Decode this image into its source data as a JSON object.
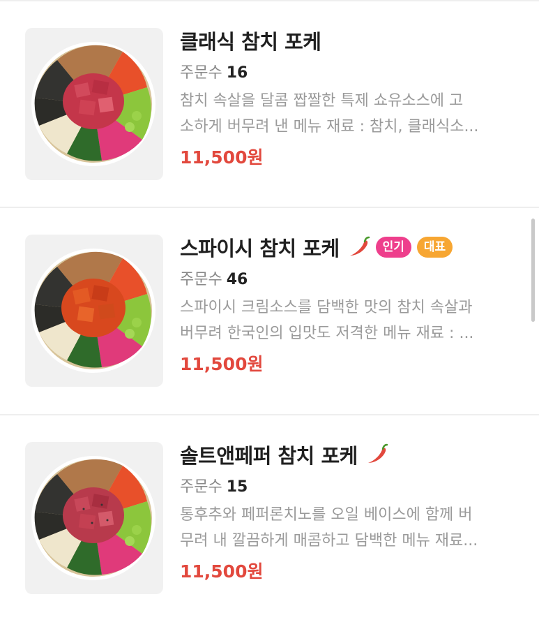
{
  "menu": {
    "orders_label": "주문수",
    "colors": {
      "price": "#e2483d",
      "badge_popular": "#ee3f8c",
      "badge_signature": "#f7a632",
      "chili": "#e2483d"
    },
    "items": [
      {
        "name": "클래식 참치 포케",
        "orders": "16",
        "desc_line1": "참치 속살을 달콤 짭짤한 특제 쇼유소스에 고",
        "desc_line2": "소하게 버무려 낸 메뉴 재료 : 참치, 클래식소...",
        "price": "11,500원",
        "tuna_style": "raw"
      },
      {
        "name": "스파이시 참치 포케",
        "orders": "46",
        "desc_line1": "스파이시 크림소스를 담백한 맛의 참치 속살과",
        "desc_line2": "버무려 한국인의 입맛도 저격한 메뉴 재료 : ...",
        "price": "11,500원",
        "icon": "chili-pepper-icon",
        "badges": [
          "인기",
          "대표"
        ],
        "tuna_style": "spicy"
      },
      {
        "name": "솔트앤페퍼 참치 포케",
        "orders": "15",
        "desc_line1": "통후추와 페퍼론치노를 오일 베이스에 함께 버",
        "desc_line2": "무려 내 깔끔하게 매콤하고 담백한 메뉴 재료...",
        "price": "11,500원",
        "icon": "chili-pepper-icon",
        "tuna_style": "raw"
      }
    ]
  }
}
